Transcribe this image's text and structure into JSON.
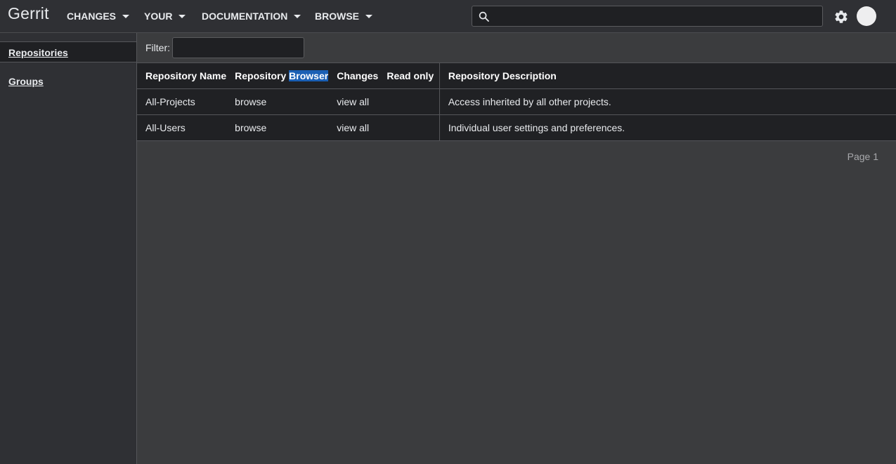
{
  "header": {
    "brand": "Gerrit",
    "menus": [
      {
        "label": "CHANGES"
      },
      {
        "label": "YOUR"
      },
      {
        "label": "DOCUMENTATION"
      },
      {
        "label": "BROWSE"
      }
    ],
    "search": {
      "value": "",
      "placeholder": ""
    },
    "icons": {
      "search": "search-icon",
      "settings": "gear-icon",
      "account": "avatar"
    }
  },
  "sidebar": {
    "items": [
      {
        "label": "Repositories",
        "selected": true
      },
      {
        "label": "Groups",
        "selected": false
      }
    ]
  },
  "filter": {
    "label": "Filter:",
    "value": ""
  },
  "table": {
    "headers": {
      "name": "Repository Name",
      "browser_prefix": "Repository",
      "browser_highlight": "Browser",
      "changes": "Changes",
      "read_only": "Read only",
      "description": "Repository Description"
    },
    "rows": [
      {
        "name": "All-Projects",
        "browser": "browse",
        "changes": "view all",
        "read_only": "",
        "description": "Access inherited by all other projects."
      },
      {
        "name": "All-Users",
        "browser": "browse",
        "changes": "view all",
        "read_only": "",
        "description": "Individual user settings and preferences."
      }
    ]
  },
  "pagination": {
    "label": "Page 1"
  },
  "colors": {
    "header_bg": "#2f3034",
    "page_bg": "#3b3c3e",
    "table_bg": "#202124",
    "selection_highlight": "#1a5fb4"
  }
}
